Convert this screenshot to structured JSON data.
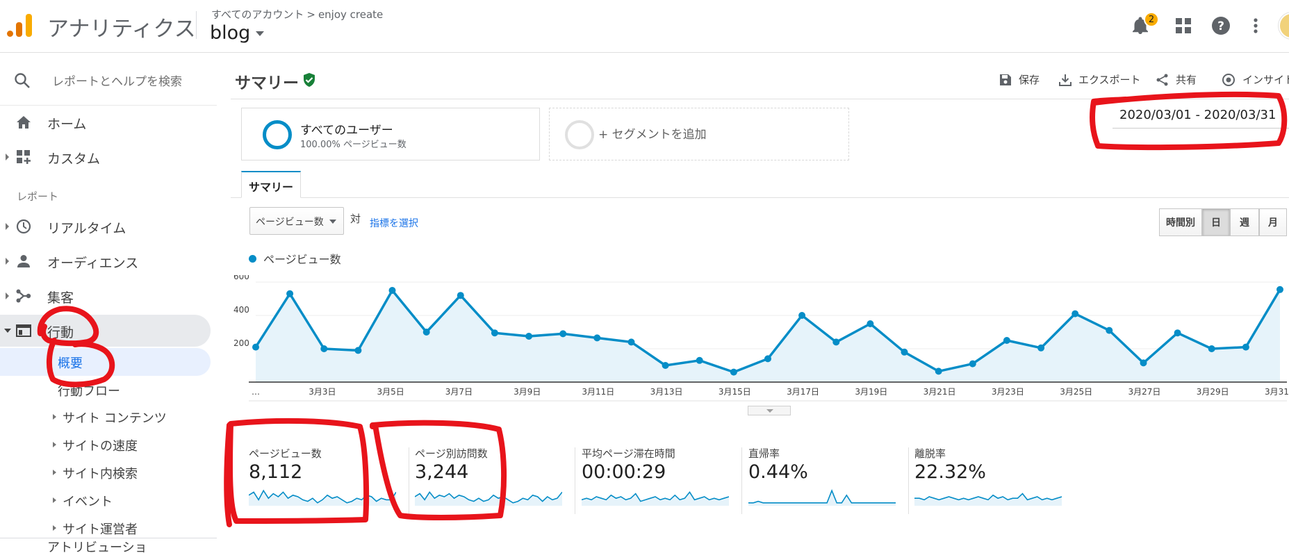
{
  "header": {
    "app_title": "アナリティクス",
    "breadcrumb": [
      "すべてのアカウント",
      "enjoy create"
    ],
    "property": "blog",
    "notification_count": "2"
  },
  "sidebar": {
    "search_placeholder": "レポートとヘルプを検索",
    "home": "ホーム",
    "custom": "カスタム",
    "section_reports": "レポート",
    "realtime": "リアルタイム",
    "audience": "オーディエンス",
    "acquisition": "集客",
    "behavior": "行動",
    "behavior_children": [
      "概要",
      "行動フロー"
    ],
    "behavior_sub": [
      "サイト コンテンツ",
      "サイトの速度",
      "サイト内検索",
      "イベント",
      "サイト運営者"
    ],
    "attribution": "アトリビューショ"
  },
  "main": {
    "title": "サマリー",
    "actions": {
      "save": "保存",
      "export": "エクスポート",
      "share": "共有",
      "insight": "インサイト"
    },
    "segment_all": {
      "title": "すべてのユーザー",
      "subtitle": "100.00% ページビュー数"
    },
    "segment_add": "+ セグメントを追加",
    "date_range": "2020/03/01 - 2020/03/31",
    "tab": "サマリー",
    "metric_select": "ページビュー数",
    "vs": "対",
    "pick_metric": "指標を選択",
    "granularity": [
      "時間別",
      "日",
      "週",
      "月"
    ],
    "granularity_active": "日"
  },
  "chart_data": {
    "type": "area",
    "title": "",
    "series": [
      {
        "name": "ページビュー数",
        "values": [
          210,
          530,
          200,
          190,
          550,
          300,
          520,
          295,
          275,
          290,
          265,
          240,
          100,
          130,
          60,
          140,
          400,
          240,
          350,
          180,
          65,
          110,
          250,
          205,
          410,
          310,
          115,
          295,
          200,
          210,
          555
        ]
      }
    ],
    "x": [
      "3月1日",
      "3月2日",
      "3月3日",
      "3月4日",
      "3月5日",
      "3月6日",
      "3月7日",
      "3月8日",
      "3月9日",
      "3月10日",
      "3月11日",
      "3月12日",
      "3月13日",
      "3月14日",
      "3月15日",
      "3月16日",
      "3月17日",
      "3月18日",
      "3月19日",
      "3月20日",
      "3月21日",
      "3月22日",
      "3月23日",
      "3月24日",
      "3月25日",
      "3月26日",
      "3月27日",
      "3月28日",
      "3月29日",
      "3月30日",
      "3月31日"
    ],
    "x_tick_labels": [
      "…",
      "3月3日",
      "3月5日",
      "3月7日",
      "3月9日",
      "3月11日",
      "3月13日",
      "3月15日",
      "3月17日",
      "3月19日",
      "3月21日",
      "3月23日",
      "3月25日",
      "3月27日",
      "3月29日",
      "3月31日"
    ],
    "y_tick_labels": [
      "600",
      "400",
      "200"
    ],
    "ylim": [
      0,
      600
    ],
    "color": "#058dc7",
    "fill": "#e6f3fa"
  },
  "scorecards": [
    {
      "label": "ページビュー数",
      "value": "8,112"
    },
    {
      "label": "ページ別訪問数",
      "value": "3,244"
    },
    {
      "label": "平均ページ滞在時間",
      "value": "00:00:29"
    },
    {
      "label": "直帰率",
      "value": "0.44%"
    },
    {
      "label": "離脱率",
      "value": "22.32%"
    }
  ],
  "colors": {
    "brand_orange": "#f9ab00",
    "accent": "#058dc7",
    "link": "#1a73e8",
    "annotation": "#e8141b"
  }
}
